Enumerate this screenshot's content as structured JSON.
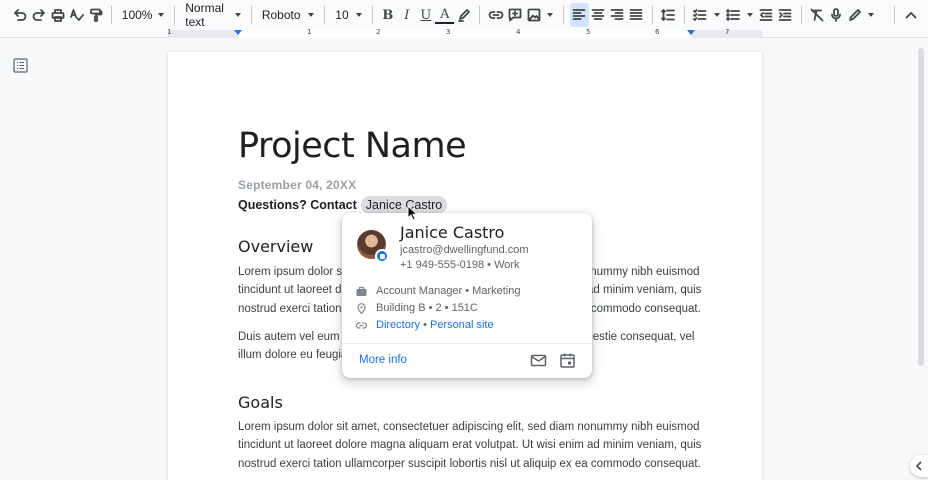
{
  "toolbar": {
    "zoom": "100%",
    "style": "Normal text",
    "font": "Roboto",
    "font_size": "10",
    "bold": "B",
    "italic": "I",
    "underline": "U",
    "text_color": "A"
  },
  "ruler": {
    "numbers": [
      "1",
      "1",
      "2",
      "3",
      "4",
      "5",
      "6",
      "7"
    ]
  },
  "doc": {
    "title": "Project Name",
    "date": "September 04, 20XX",
    "contact_prefix": "Questions? Contact",
    "contact_chip": "Janice Castro",
    "overview_heading": "Overview",
    "overview_p1": [
      "Lorem ipsum dolor sit amet, consectetuer adipiscing elit, sed diam nonummy nibh euismod",
      "tincidunt ut laoreet dolore magna aliquam erat volutpat. Ut wisi enim ad minim veniam, quis",
      "nostrud exerci tation ullamcorper suscipit lobortis nisl ut aliquip ex ea commodo consequat."
    ],
    "overview_p2": [
      "Duis autem vel eum iriure dolor in hendrerit in vulputate velit esse molestie consequat, vel",
      "illum dolore eu feugiat nulla facilisis."
    ],
    "goals_heading": "Goals",
    "goals_p1": [
      "Lorem ipsum dolor sit amet, consectetuer adipiscing elit, sed diam nonummy nibh euismod",
      "tincidunt ut laoreet dolore magna aliquam erat volutpat. Ut wisi enim ad minim veniam, quis",
      "nostrud exerci tation ullamcorper suscipit lobortis nisl ut aliquip ex ea commodo consequat."
    ]
  },
  "card": {
    "name": "Janice Castro",
    "email": "jcastro@dwellingfund.com",
    "phone": "+1 949-555-0198 • Work",
    "role": "Account Manager • Marketing",
    "location": "Building B • 2 • 151C",
    "directory": "Directory",
    "separator": " • ",
    "personal_site": "Personal site",
    "more_info": "More info"
  },
  "colors": {
    "accent": "#1a73e8",
    "chip": "#dadce0",
    "page": "#ffffff",
    "canvas": "#f8f9fa"
  }
}
